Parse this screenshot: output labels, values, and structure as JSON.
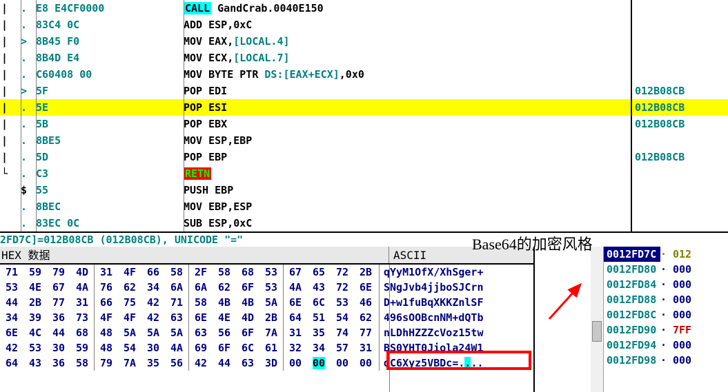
{
  "disasm": {
    "rows": [
      {
        "jump": "|",
        "mark": ".",
        "hex": "E8 E4CF0000",
        "asm_pre": "",
        "asm_call": "CALL",
        "asm_call_arg": " GandCrab.0040E150",
        "asm_post": "",
        "ref": "",
        "hl": false,
        "call": true
      },
      {
        "jump": "|",
        "mark": ".",
        "hex": "83C4 0C",
        "asm": "ADD ESP,0xC",
        "ref": ""
      },
      {
        "jump": "|",
        "mark": ">",
        "hex": "8B45 F0",
        "asm": "MOV EAX,[LOCAL.4]",
        "ref": "",
        "mem": "[LOCAL.4]"
      },
      {
        "jump": "|",
        "mark": ".",
        "hex": "8B4D E4",
        "asm": "MOV ECX,[LOCAL.7]",
        "ref": "",
        "mem": "[LOCAL.7]"
      },
      {
        "jump": "|",
        "mark": ".",
        "hex": "C60408 00",
        "asm": "MOV BYTE PTR DS:[EAX+ECX],0x0",
        "ref": "",
        "mem": "DS:[EAX+ECX]"
      },
      {
        "jump": "|",
        "mark": ">",
        "hex": "5F",
        "asm": "POP EDI",
        "ref": "012B08CB"
      },
      {
        "jump": "|",
        "mark": ".",
        "hex": "5E",
        "asm": "POP ESI",
        "ref": "012B08CB",
        "hl": true
      },
      {
        "jump": "|",
        "mark": ".",
        "hex": "5B",
        "asm": "POP EBX",
        "ref": "012B08CB"
      },
      {
        "jump": "|",
        "mark": ".",
        "hex": "8BE5",
        "asm": "MOV ESP,EBP",
        "ref": ""
      },
      {
        "jump": "|",
        "mark": ".",
        "hex": "5D",
        "asm": "POP EBP",
        "ref": "012B08CB"
      },
      {
        "jump": "└",
        "mark": ".",
        "hex": "C3",
        "asm": "RETN",
        "ref": "",
        "retn": true
      },
      {
        "jump": " ",
        "mark": "$",
        "hex": "55",
        "asm": "PUSH EBP",
        "ref": "",
        "markcolor": "#000000"
      },
      {
        "jump": " ",
        "mark": ".",
        "hex": "8BEC",
        "asm": "MOV EBP,ESP",
        "ref": ""
      },
      {
        "jump": " ",
        "mark": ".",
        "hex": "83EC 0C",
        "asm": "SUB ESP,0xC",
        "ref": ""
      }
    ]
  },
  "status": "2FD7C]=012B08CB (012B08CB), UNICODE \"=\"",
  "annotation": "Base64的加密风格",
  "hex": {
    "header_hex": "HEX 数据",
    "header_ascii": "ASCII",
    "rows": [
      {
        "g": [
          [
            "71",
            "59",
            "79",
            "4D"
          ],
          [
            "31",
            "4F",
            "66",
            "58"
          ],
          [
            "2F",
            "58",
            "68",
            "53"
          ],
          [
            "67",
            "65",
            "72",
            "2B"
          ]
        ],
        "ascii": "qYyM1OfX/XhSger+"
      },
      {
        "g": [
          [
            "53",
            "4E",
            "67",
            "4A"
          ],
          [
            "76",
            "62",
            "34",
            "6A"
          ],
          [
            "6A",
            "62",
            "6F",
            "53"
          ],
          [
            "4A",
            "43",
            "72",
            "6E"
          ]
        ],
        "ascii": "SNgJvb4jjboSJCrn"
      },
      {
        "g": [
          [
            "44",
            "2B",
            "77",
            "31"
          ],
          [
            "66",
            "75",
            "42",
            "71"
          ],
          [
            "58",
            "4B",
            "4B",
            "5A"
          ],
          [
            "6E",
            "6C",
            "53",
            "46"
          ]
        ],
        "ascii": "D+w1fuBqXKKZnlSF"
      },
      {
        "g": [
          [
            "34",
            "39",
            "36",
            "73"
          ],
          [
            "4F",
            "4F",
            "42",
            "63"
          ],
          [
            "6E",
            "4E",
            "4D",
            "2B"
          ],
          [
            "64",
            "51",
            "54",
            "62"
          ]
        ],
        "ascii": "496sOOBcnNM+dQTb"
      },
      {
        "g": [
          [
            "6E",
            "4C",
            "44",
            "68"
          ],
          [
            "48",
            "5A",
            "5A",
            "5A"
          ],
          [
            "63",
            "56",
            "6F",
            "7A"
          ],
          [
            "31",
            "35",
            "74",
            "77"
          ]
        ],
        "ascii": "nLDhHZZZcVoz15tw"
      },
      {
        "g": [
          [
            "42",
            "53",
            "30",
            "59"
          ],
          [
            "48",
            "54",
            "30",
            "4A"
          ],
          [
            "69",
            "6F",
            "6C",
            "61"
          ],
          [
            "32",
            "34",
            "57",
            "31"
          ]
        ],
        "ascii": "BS0YHT0Jiola24W1"
      },
      {
        "g": [
          [
            "64",
            "43",
            "36",
            "58"
          ],
          [
            "79",
            "7A",
            "35",
            "56"
          ],
          [
            "42",
            "44",
            "63",
            "3D"
          ],
          [
            "00",
            "00",
            "00",
            "00"
          ]
        ],
        "ascii": "dC6Xyz5VBDc=....",
        "hlbyte": 13,
        "hlascii": 13
      }
    ]
  },
  "stack": {
    "rows": [
      {
        "addr": "0012FD7C",
        "sep": "·",
        "val": "012",
        "first": true
      },
      {
        "addr": "0012FD80",
        "sep": "·",
        "val": "000"
      },
      {
        "addr": "0012FD84",
        "sep": "·",
        "val": "000"
      },
      {
        "addr": "0012FD88",
        "sep": "·",
        "val": "000"
      },
      {
        "addr": "0012FD8C",
        "sep": "·",
        "val": "000"
      },
      {
        "addr": "0012FD90",
        "sep": "·",
        "val": "7FF",
        "red": true
      },
      {
        "addr": "0012FD94",
        "sep": "·",
        "val": "000"
      },
      {
        "addr": "0012FD98",
        "sep": "·",
        "val": "000"
      }
    ]
  }
}
